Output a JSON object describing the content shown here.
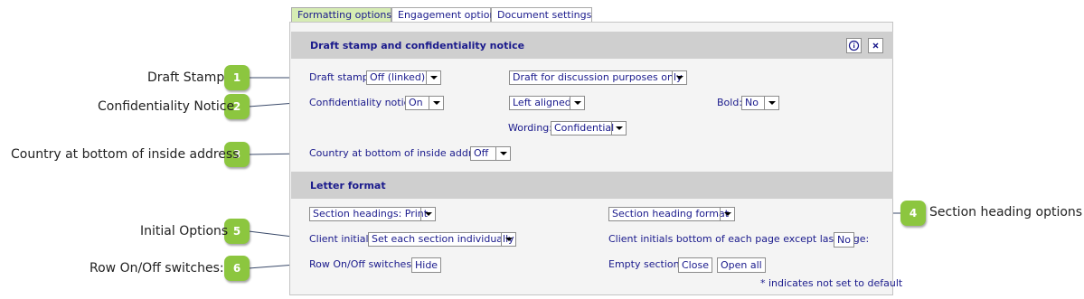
{
  "tabs": [
    {
      "label": "Formatting options",
      "active": true
    },
    {
      "label": "Engagement options",
      "active": false
    },
    {
      "label": "Document settings",
      "active": false
    }
  ],
  "sections": {
    "draft": {
      "title": "Draft stamp and confidentiality notice"
    },
    "letter": {
      "title": "Letter format"
    }
  },
  "icons": {
    "info": "info-icon",
    "close": "close-icon"
  },
  "fields": {
    "draft_stamp": {
      "label": "Draft stamp:",
      "value": "Off (linked)"
    },
    "draft_text": {
      "value": "Draft for discussion purposes only"
    },
    "confidentiality": {
      "label": "Confidentiality notice:",
      "value": "On"
    },
    "alignment": {
      "value": "Left aligned"
    },
    "bold": {
      "label": "Bold:",
      "value": "No"
    },
    "wording": {
      "label": "Wording:",
      "value": "Confidential"
    },
    "country": {
      "label": "Country at bottom of inside address:",
      "value": "Off"
    },
    "section_headings": {
      "value": "Section headings: Print"
    },
    "section_heading_format": {
      "value": "Section heading format"
    },
    "client_initials": {
      "label": "Client initials:",
      "value": "Set each section individually"
    },
    "initials_bottom": {
      "label": "Client initials bottom of each page except last page:",
      "value": "No"
    },
    "row_switches": {
      "label": "Row On/Off switches:",
      "value": "Hide"
    },
    "empty_sections": {
      "label": "Empty sections:",
      "close": "Close",
      "open_all": "Open all"
    }
  },
  "footnote": "* indicates not set to default",
  "callouts": [
    {
      "num": "1",
      "label": "Draft Stamp"
    },
    {
      "num": "2",
      "label": "Confidentiality Notice"
    },
    {
      "num": "3",
      "label": "Country at bottom of inside address"
    },
    {
      "num": "4",
      "label": "Section heading options"
    },
    {
      "num": "5",
      "label": "Initial Options"
    },
    {
      "num": "6",
      "label": "Row On/Off switches:"
    }
  ],
  "colors": {
    "accent_green": "#8cc63f",
    "tab_active": "#d6ecb4",
    "label_blue": "#1a1a8c",
    "header_gray": "#cfcfcf"
  }
}
